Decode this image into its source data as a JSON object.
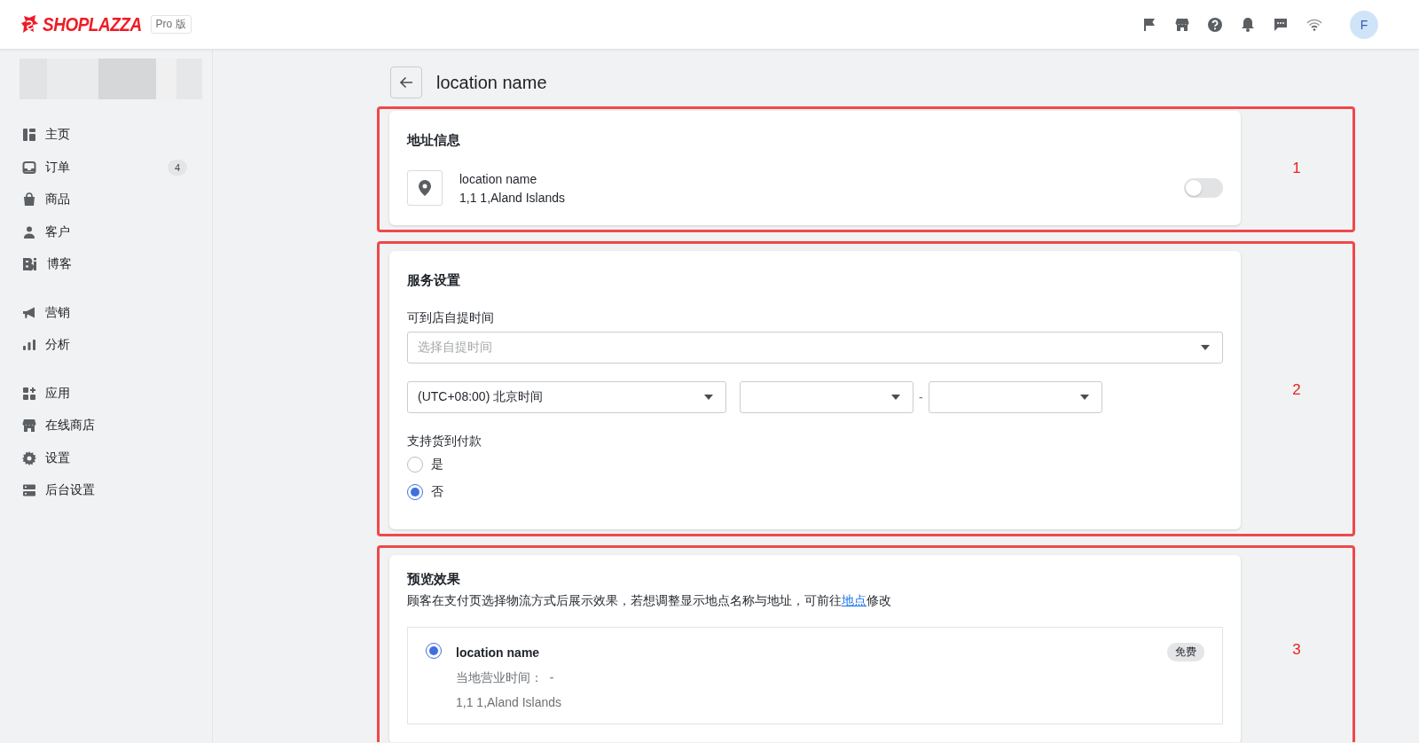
{
  "topbar": {
    "brand": "SHOPLAZZA",
    "plan_badge": "Pro 版",
    "avatar_initial": "F"
  },
  "sidebar": {
    "groups": [
      [
        {
          "kind": "dashboard",
          "label": "主页",
          "selected": false
        },
        {
          "kind": "inbox",
          "label": "订单",
          "badge": "4",
          "selected": false
        },
        {
          "kind": "bag",
          "label": "商品",
          "selected": false
        },
        {
          "kind": "person",
          "label": "客户",
          "selected": false
        },
        {
          "kind": "blog",
          "label": "博客",
          "selected": false
        }
      ],
      [
        {
          "kind": "megaphone",
          "label": "营销",
          "selected": false
        },
        {
          "kind": "bars",
          "label": "分析",
          "selected": false
        }
      ],
      [
        {
          "kind": "apps",
          "label": "应用",
          "selected": false
        },
        {
          "kind": "store",
          "label": "在线商店",
          "selected": false
        },
        {
          "kind": "gear",
          "label": "设置",
          "selected": false
        },
        {
          "kind": "server",
          "label": "后台设置",
          "selected": false
        }
      ]
    ]
  },
  "page_title": "location name",
  "sections": [
    {
      "kind": "address",
      "annotation": "1",
      "title": "地址信息",
      "location": {
        "name": "location name",
        "address": "1,1 1,Aland Islands"
      },
      "toggle": {
        "on": false
      }
    },
    {
      "kind": "service",
      "annotation": "2",
      "title": "服务设置",
      "pickup_label": "可到店自提时间",
      "pickup_select": {
        "placeholder": "选择自提时间"
      },
      "timezone_select": {
        "value": "(UTC+08:00) 北京时间"
      },
      "range_separator": "-",
      "cod_label": "支持货到付款",
      "cod_options": [
        {
          "label": "是",
          "selected": false
        },
        {
          "label": "否",
          "selected": true
        }
      ]
    },
    {
      "kind": "preview",
      "annotation": "3",
      "title": "预览效果",
      "description_before": "顾客在支付页选择物流方式后展示效果，若想调整显示地点名称与地址，可前往",
      "description_link": "地点",
      "description_after": "修改",
      "preview": {
        "selected": true,
        "name": "location name",
        "price_badge": "免费",
        "hours": "当地营业时间：  -",
        "address": "1,1 1,Aland Islands"
      }
    }
  ]
}
